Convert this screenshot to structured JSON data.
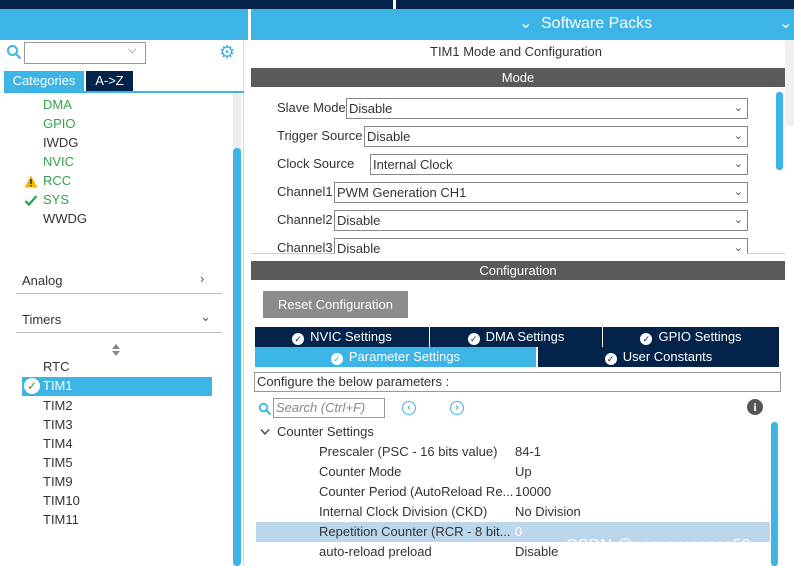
{
  "header": {
    "software_packs_label": "Software Packs"
  },
  "left": {
    "tabs": {
      "categories": "Categories",
      "az": "A->Z"
    },
    "system_items": [
      {
        "label": "DMA",
        "status": "ok"
      },
      {
        "label": "GPIO",
        "status": "ok"
      },
      {
        "label": "IWDG",
        "status": "none"
      },
      {
        "label": "NVIC",
        "status": "ok"
      },
      {
        "label": "RCC",
        "status": "warning"
      },
      {
        "label": "SYS",
        "status": "check"
      },
      {
        "label": "WWDG",
        "status": "none"
      }
    ],
    "sections": {
      "analog": "Analog",
      "timers": "Timers"
    },
    "timers": [
      "RTC",
      "TIM1",
      "TIM2",
      "TIM3",
      "TIM4",
      "TIM5",
      "TIM9",
      "TIM10",
      "TIM11"
    ],
    "selected_timer": "TIM1"
  },
  "mode": {
    "title": "TIM1 Mode and Configuration",
    "header": "Mode",
    "rows": [
      {
        "label": "Slave Mode",
        "value": "Disable"
      },
      {
        "label": "Trigger Source",
        "value": "Disable"
      },
      {
        "label": "Clock Source",
        "value": "Internal Clock"
      },
      {
        "label": "Channel1",
        "value": "PWM Generation CH1"
      },
      {
        "label": "Channel2",
        "value": "Disable"
      },
      {
        "label": "Channel3",
        "value": "Disable"
      }
    ]
  },
  "config": {
    "header": "Configuration",
    "reset_button": "Reset Configuration",
    "tabs_row1": [
      "NVIC Settings",
      "DMA Settings",
      "GPIO Settings"
    ],
    "tabs_row2": [
      "Parameter Settings",
      "User Constants"
    ],
    "active_tab": "Parameter Settings",
    "description": "Configure the below parameters :",
    "search_placeholder": "Search (Ctrl+F)",
    "group": "Counter Settings",
    "params": [
      {
        "name": "Prescaler (PSC - 16 bits value)",
        "value": "84-1"
      },
      {
        "name": "Counter Mode",
        "value": "Up"
      },
      {
        "name": "Counter Period (AutoReload Re...",
        "value": "10000"
      },
      {
        "name": "Internal Clock Division (CKD)",
        "value": "No Division"
      },
      {
        "name": "Repetition Counter (RCR - 8 bit...",
        "value": "0"
      },
      {
        "name": "auto-reload preload",
        "value": "Disable"
      }
    ]
  },
  "watermark": "CSDN @perseverance52",
  "colors": {
    "accent": "#3cb4e6",
    "dark_navy": "#03234b",
    "header_gray": "#5a5a5a",
    "ok_green": "#2ea44f",
    "warning_yellow": "#f2b705"
  }
}
